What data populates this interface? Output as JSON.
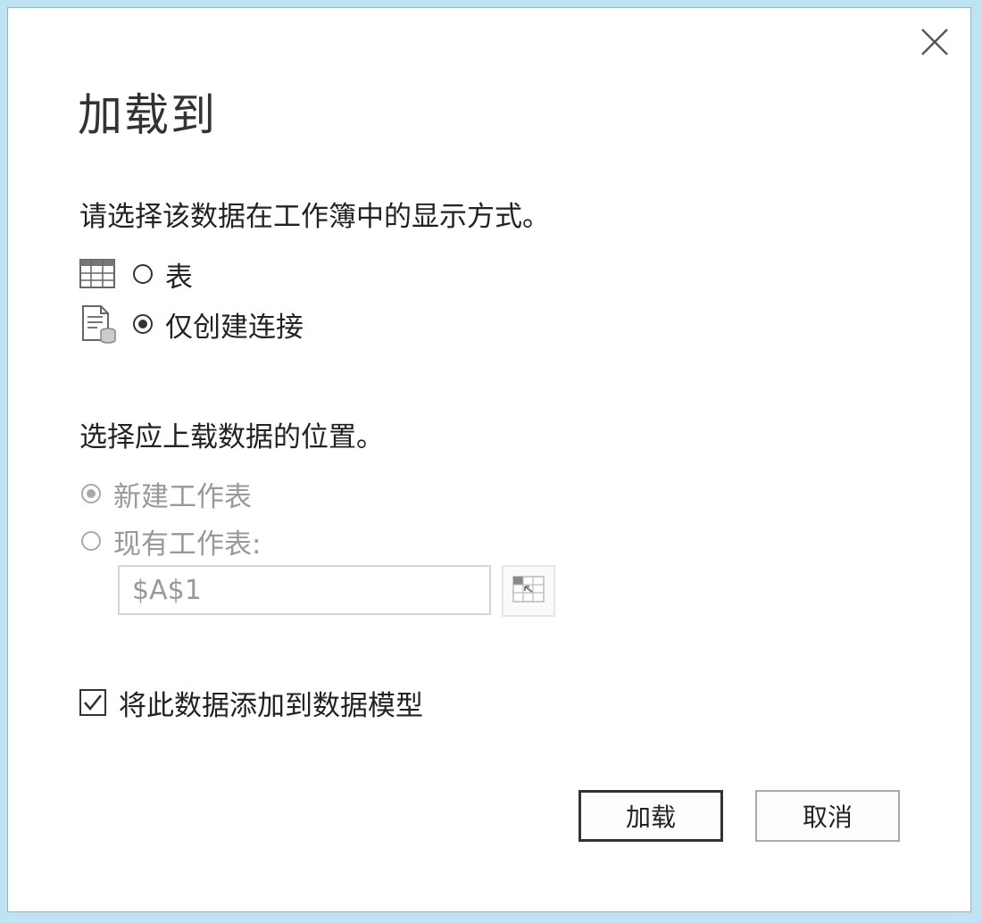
{
  "dialog": {
    "title": "加载到",
    "close_icon": "close-icon"
  },
  "display_section": {
    "label": "请选择该数据在工作簿中的显示方式。",
    "options": [
      {
        "label": "表",
        "icon": "table-icon",
        "checked": false
      },
      {
        "label": "仅创建连接",
        "icon": "connection-icon",
        "checked": true
      }
    ]
  },
  "location_section": {
    "label": "选择应上载数据的位置。",
    "options": [
      {
        "label": "新建工作表",
        "checked": true,
        "disabled": true
      },
      {
        "label": "现有工作表:",
        "checked": false,
        "disabled": true
      }
    ],
    "cell_ref": {
      "value": "$A$1"
    },
    "ref_button_icon": "range-select-icon"
  },
  "data_model": {
    "label": "将此数据添加到数据模型",
    "checked": true
  },
  "buttons": {
    "load": "加载",
    "cancel": "取消"
  }
}
